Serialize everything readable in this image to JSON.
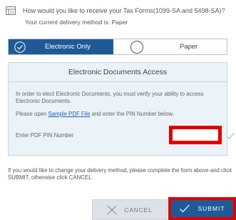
{
  "question": {
    "text": "How would you like to receive your Tax Forms(1099-SA and 5498-SA)?",
    "icon": "form-icon"
  },
  "current_delivery": "Your current delivery method is: Paper",
  "delivery_options": {
    "electronic_label": "Electronic Only",
    "paper_label": "Paper",
    "selected": "Electronic Only"
  },
  "panel": {
    "title": "Electronic Documents Access",
    "paragraph1": "In order to elect Electronic Documents, you must verify your ability to access Electronic Documents.",
    "paragraph2_prefix": "Please open ",
    "paragraph2_link": "Sample PDF File",
    "paragraph2_suffix": " and enter the PIN Number below.",
    "pin_label": "Enter PDF PIN Number",
    "pin_value": ""
  },
  "footer_note": "If you would like to change your delivery method, please complete the form above and click SUBMIT, otherwise click CANCEL",
  "buttons": {
    "cancel_label": "CANCEL",
    "submit_label": "SUBMIT"
  },
  "colors": {
    "primary": "#1f5a96",
    "highlight": "#e00000",
    "panel_bg": "#ebf2f8"
  }
}
